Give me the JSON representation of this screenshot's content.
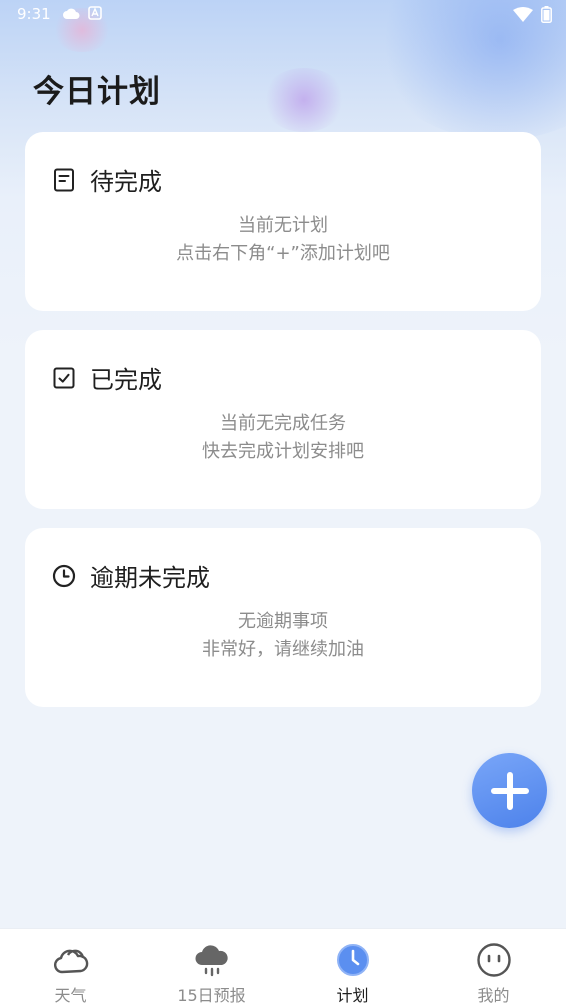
{
  "status_bar": {
    "time": "9:31"
  },
  "page": {
    "title": "今日计划"
  },
  "cards": [
    {
      "title": "待完成",
      "icon": "note-icon",
      "line1": "当前无计划",
      "line2": "点击右下角“+”添加计划吧"
    },
    {
      "title": "已完成",
      "icon": "checkbox-icon",
      "line1": "当前无完成任务",
      "line2": "快去完成计划安排吧"
    },
    {
      "title": "逾期未完成",
      "icon": "clock-icon",
      "line1": "无逾期事项",
      "line2": "非常好，请继续加油"
    }
  ],
  "fab": {
    "icon": "plus-icon"
  },
  "tabbar": {
    "tabs": [
      {
        "label": "天气",
        "icon": "cloud-icon"
      },
      {
        "label": "15日预报",
        "icon": "rain-cloud-icon"
      },
      {
        "label": "计划",
        "icon": "clock-icon",
        "active": true
      },
      {
        "label": "我的",
        "icon": "face-icon"
      }
    ]
  },
  "colors": {
    "accent": "#4d82eb",
    "background": "#eef3fa",
    "card": "#ffffff",
    "muted_text": "#8c8c8c"
  }
}
